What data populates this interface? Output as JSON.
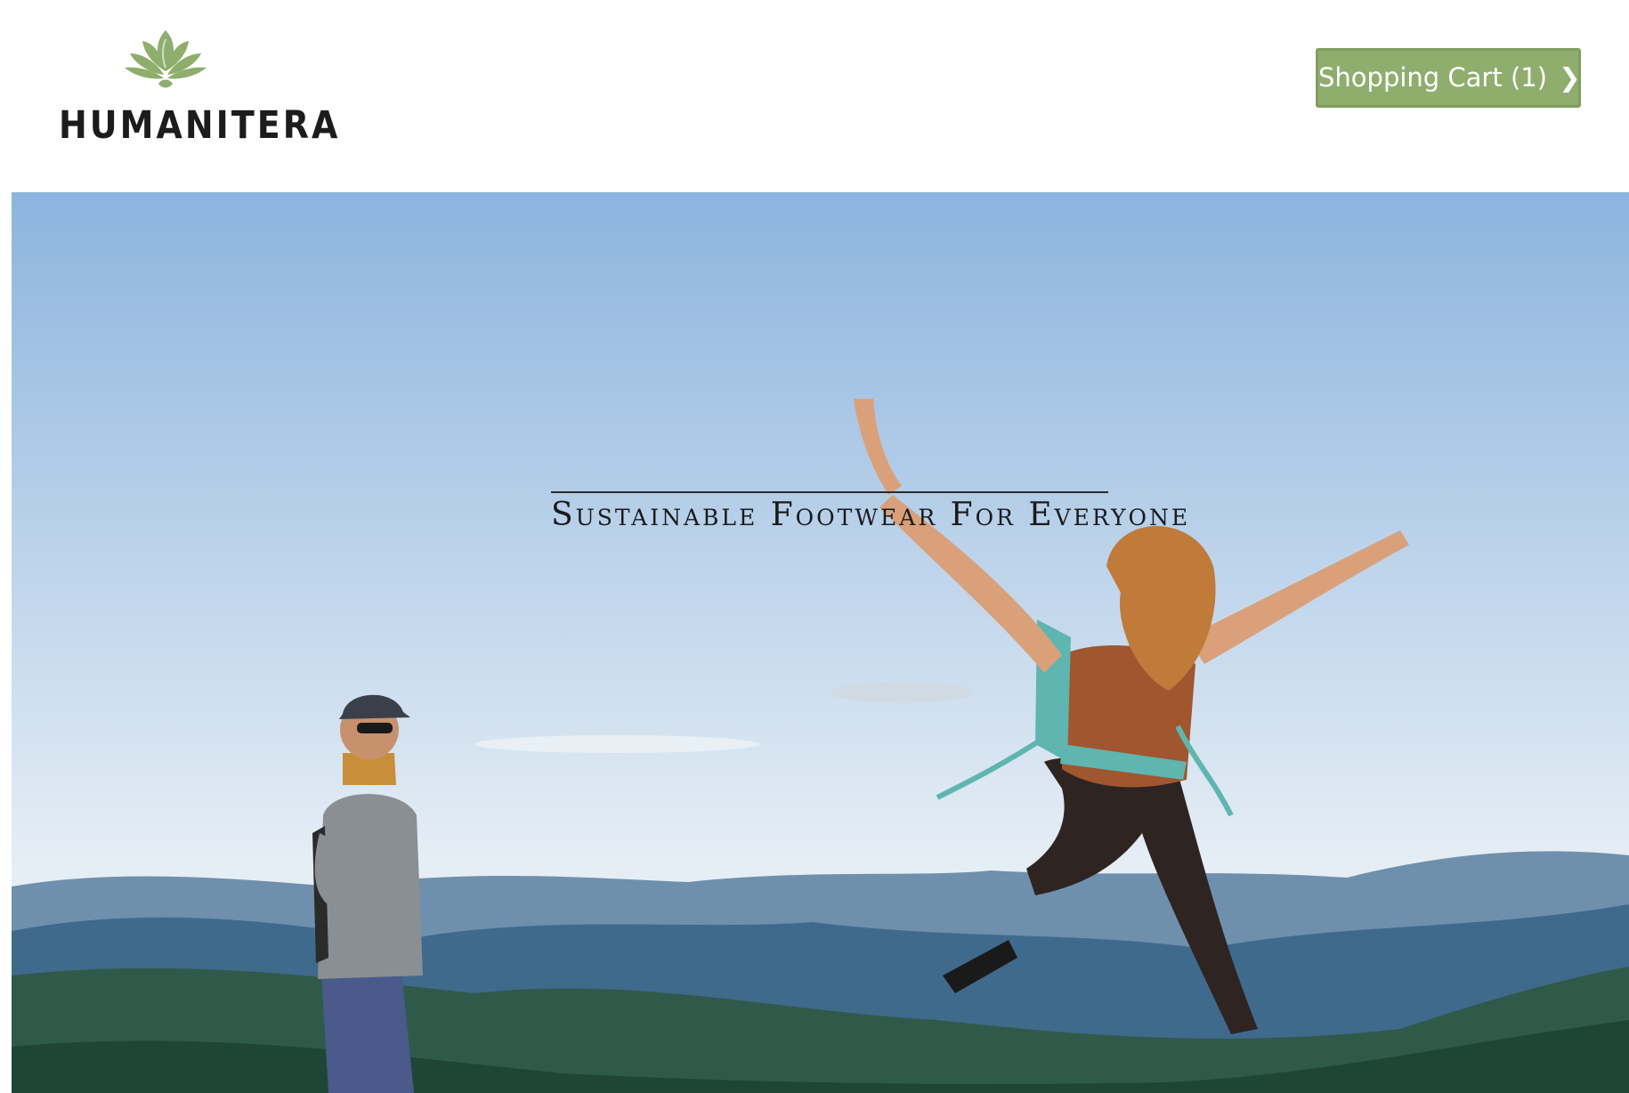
{
  "brand": {
    "name": "HUMANITERA",
    "logo_icon": "lotus-icon",
    "accent_color": "#8fae6e"
  },
  "header": {
    "cart_label": "Shopping Cart (1)",
    "cart_icon": "chevron-right-icon",
    "cart_chevron": "❯"
  },
  "hero": {
    "tagline": "Sustainable Footwear For Everyone",
    "sky_top_color": "#8cb4de",
    "sky_bottom_color": "#e6eef5",
    "mountain_color": "#3f6a8c",
    "forest_color": "#2f5a4a"
  }
}
